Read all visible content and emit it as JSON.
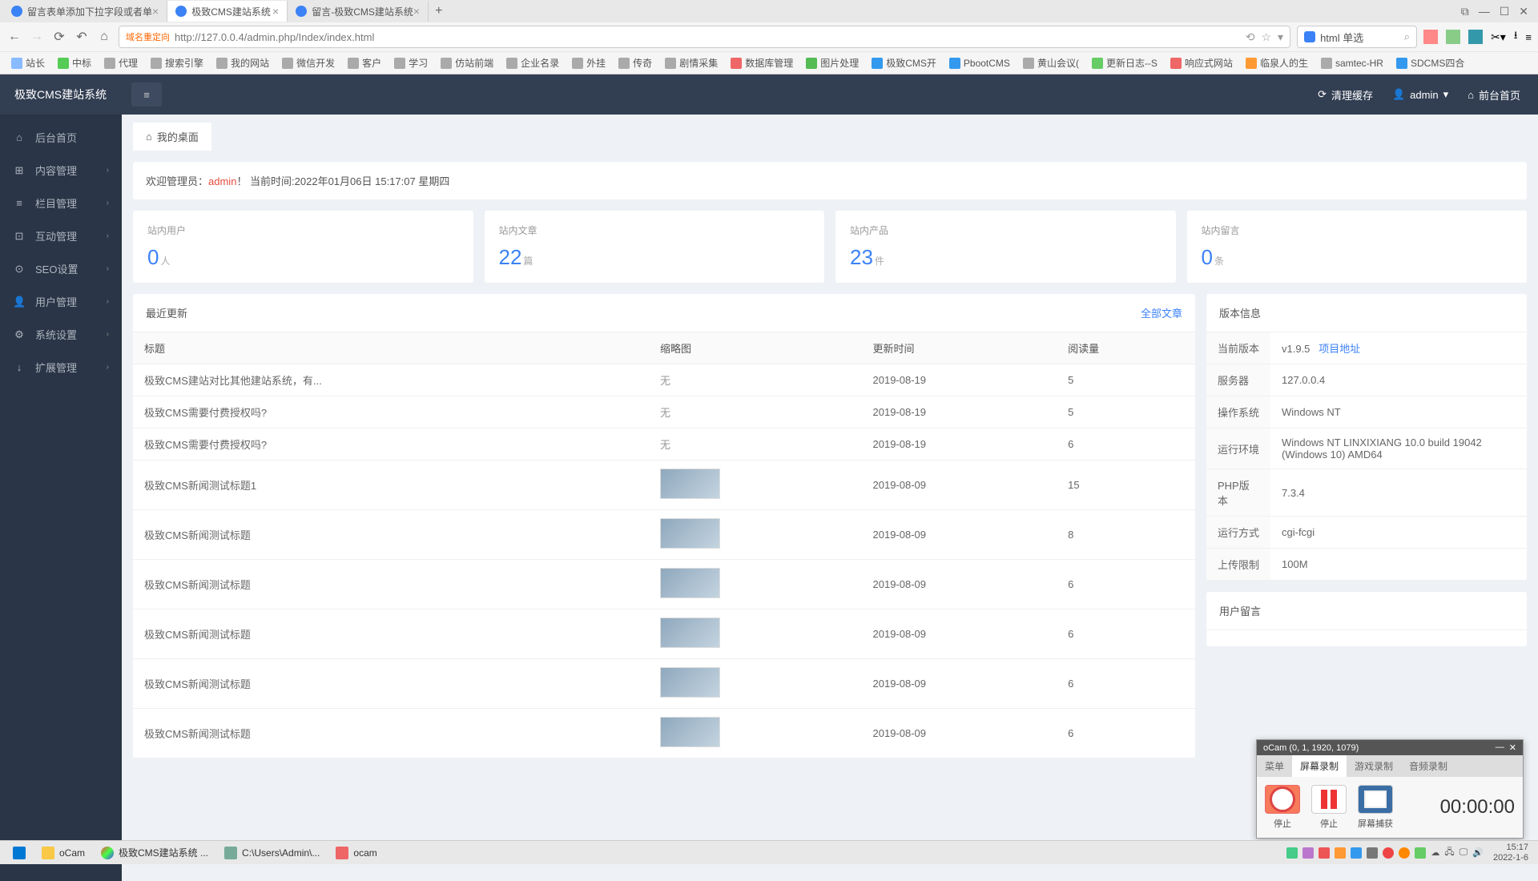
{
  "browser": {
    "tabs": [
      {
        "title": "留言表单添加下拉字段或者单",
        "active": false
      },
      {
        "title": "极致CMS建站系统",
        "active": true
      },
      {
        "title": "留言-极致CMS建站系统",
        "active": false
      }
    ],
    "url_badge": "域名重定向",
    "url": "http://127.0.0.4/admin.php/Index/index.html",
    "search_text": "html 单选",
    "bookmarks": [
      "站长",
      "中标",
      "代理",
      "搜索引擎",
      "我的网站",
      "微信开发",
      "客户",
      "学习",
      "仿站前端",
      "企业名录",
      "外挂",
      "传奇",
      "剧情采集",
      "数据库管理",
      "图片处理",
      "极致CMS开",
      "PbootCMS",
      "黄山会议(",
      "更新日志--S",
      "响应式网站",
      "临泉人的生",
      "samtec-HR",
      "SDCMS四合"
    ]
  },
  "topbar": {
    "brand": "极致CMS建站系统",
    "clear_cache": "清理缓存",
    "admin": "admin",
    "front": "前台首页"
  },
  "sidebar": {
    "items": [
      {
        "icon": "⌂",
        "label": "后台首页",
        "chevron": false
      },
      {
        "icon": "⊞",
        "label": "内容管理",
        "chevron": true
      },
      {
        "icon": "≡",
        "label": "栏目管理",
        "chevron": true
      },
      {
        "icon": "⊡",
        "label": "互动管理",
        "chevron": true
      },
      {
        "icon": "⊙",
        "label": "SEO设置",
        "chevron": true
      },
      {
        "icon": "👤",
        "label": "用户管理",
        "chevron": true
      },
      {
        "icon": "⚙",
        "label": "系统设置",
        "chevron": true
      },
      {
        "icon": "↓",
        "label": "扩展管理",
        "chevron": true
      }
    ]
  },
  "page_tab": "我的桌面",
  "welcome": {
    "prefix": "欢迎管理员：",
    "name": "admin",
    "suffix": "！ 当前时间:2022年01月06日 15:17:07 星期四"
  },
  "stats": [
    {
      "label": "站内用户",
      "value": "0",
      "unit": "人"
    },
    {
      "label": "站内文章",
      "value": "22",
      "unit": "篇"
    },
    {
      "label": "站内产品",
      "value": "23",
      "unit": "件"
    },
    {
      "label": "站内留言",
      "value": "0",
      "unit": "条"
    }
  ],
  "recent": {
    "title": "最近更新",
    "all_link": "全部文章",
    "headers": [
      "标题",
      "缩略图",
      "更新时间",
      "阅读量"
    ],
    "rows": [
      {
        "title": "极致CMS建站对比其他建站系统，有...",
        "thumb": "无",
        "date": "2019-08-19",
        "views": "5"
      },
      {
        "title": "极致CMS需要付费授权吗?",
        "thumb": "无",
        "date": "2019-08-19",
        "views": "5"
      },
      {
        "title": "极致CMS需要付费授权吗?",
        "thumb": "无",
        "date": "2019-08-19",
        "views": "6"
      },
      {
        "title": "极致CMS新闻测试标题1",
        "thumb": "img",
        "date": "2019-08-09",
        "views": "15"
      },
      {
        "title": "极致CMS新闻测试标题",
        "thumb": "img",
        "date": "2019-08-09",
        "views": "8"
      },
      {
        "title": "极致CMS新闻测试标题",
        "thumb": "img",
        "date": "2019-08-09",
        "views": "6"
      },
      {
        "title": "极致CMS新闻测试标题",
        "thumb": "img",
        "date": "2019-08-09",
        "views": "6"
      },
      {
        "title": "极致CMS新闻测试标题",
        "thumb": "img",
        "date": "2019-08-09",
        "views": "6"
      },
      {
        "title": "极致CMS新闻测试标题",
        "thumb": "img",
        "date": "2019-08-09",
        "views": "6"
      }
    ]
  },
  "version": {
    "title": "版本信息",
    "rows": [
      {
        "k": "当前版本",
        "v": "v1.9.5",
        "link": "项目地址"
      },
      {
        "k": "服务器",
        "v": "127.0.0.4"
      },
      {
        "k": "操作系统",
        "v": "Windows NT"
      },
      {
        "k": "运行环境",
        "v": "Windows NT LINXIXIANG 10.0 build 19042 (Windows 10) AMD64"
      },
      {
        "k": "PHP版本",
        "v": "7.3.4"
      },
      {
        "k": "运行方式",
        "v": "cgi-fcgi"
      },
      {
        "k": "上传限制",
        "v": "100M"
      }
    ],
    "user_msg": "用户留言"
  },
  "taskbar": {
    "items": [
      "oCam",
      "极致CMS建站系统 ...",
      "C:\\Users\\Admin\\...",
      "ocam"
    ],
    "time": "15:17",
    "date": "2022-1-6"
  },
  "ocam": {
    "title": "oCam (0, 1, 1920, 1079)",
    "tabs": [
      "菜单",
      "屏幕录制",
      "游戏录制",
      "音频录制"
    ],
    "buttons": [
      "停止",
      "停止",
      "屏幕捕获"
    ],
    "time": "00:00:00"
  }
}
